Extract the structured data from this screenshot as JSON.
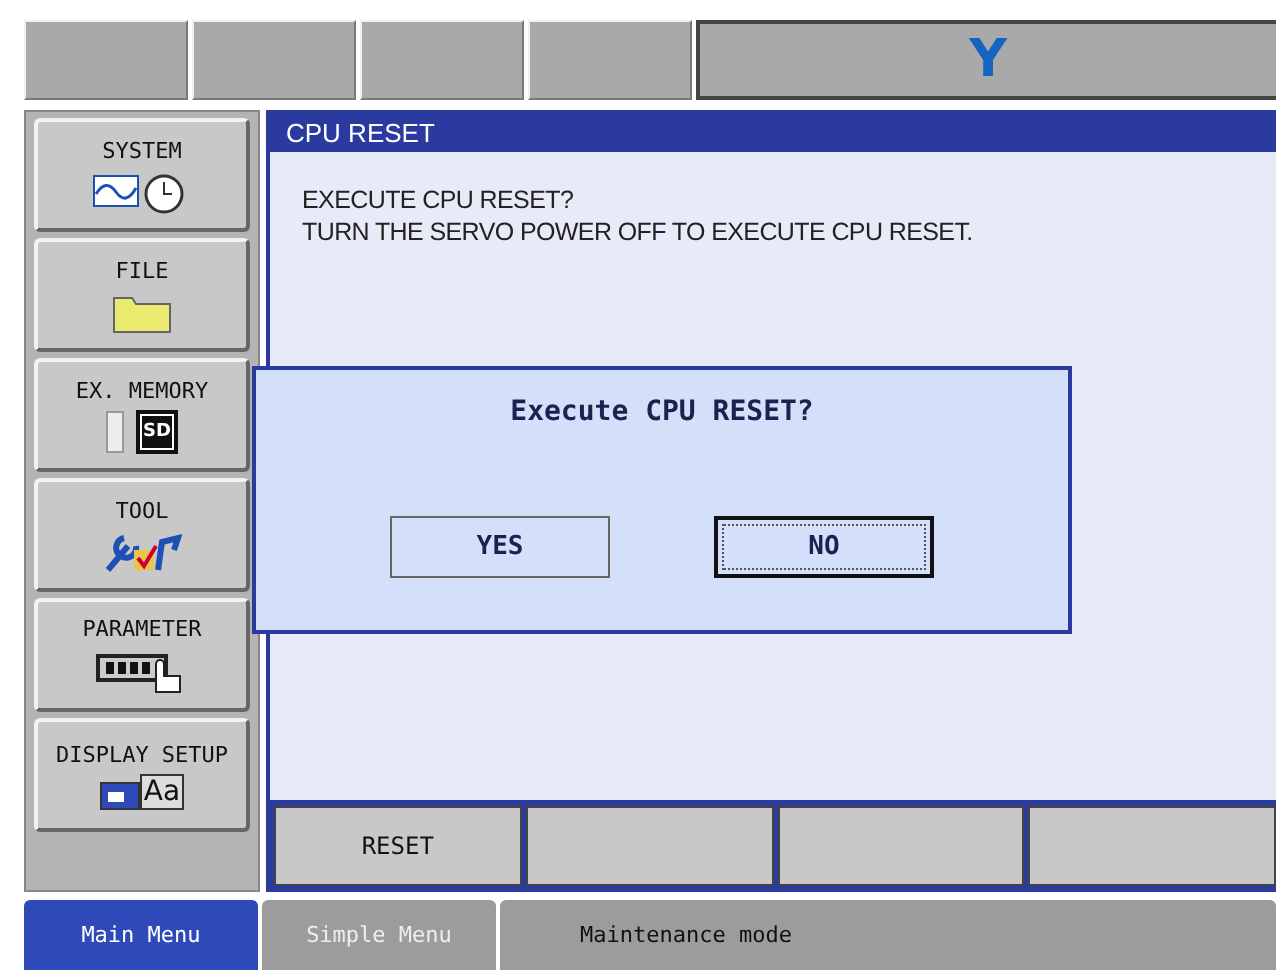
{
  "header": {
    "logo": "Y"
  },
  "sidebar": {
    "items": [
      {
        "label": "SYSTEM",
        "kind": "system"
      },
      {
        "label": "FILE",
        "kind": "file"
      },
      {
        "label": "EX. MEMORY",
        "kind": "memory",
        "icon_label": "SD"
      },
      {
        "label": "TOOL",
        "kind": "tool"
      },
      {
        "label": "PARAMETER",
        "kind": "parameter"
      },
      {
        "label": "DISPLAY SETUP",
        "kind": "display",
        "icon_label": "Aa"
      }
    ]
  },
  "window": {
    "title": "CPU RESET",
    "lines": [
      "EXECUTE CPU RESET?",
      "TURN THE SERVO POWER OFF TO EXECUTE CPU RESET."
    ]
  },
  "dialog": {
    "message": "Execute CPU RESET?",
    "buttons": [
      {
        "label": "YES",
        "focused": false
      },
      {
        "label": "NO",
        "focused": true
      }
    ]
  },
  "function_keys": [
    {
      "label": "RESET"
    }
  ],
  "bottom_tabs": [
    {
      "label": "Main Menu",
      "selected": true
    },
    {
      "label": "Simple Menu",
      "selected": false
    }
  ],
  "status": "Maintenance mode"
}
